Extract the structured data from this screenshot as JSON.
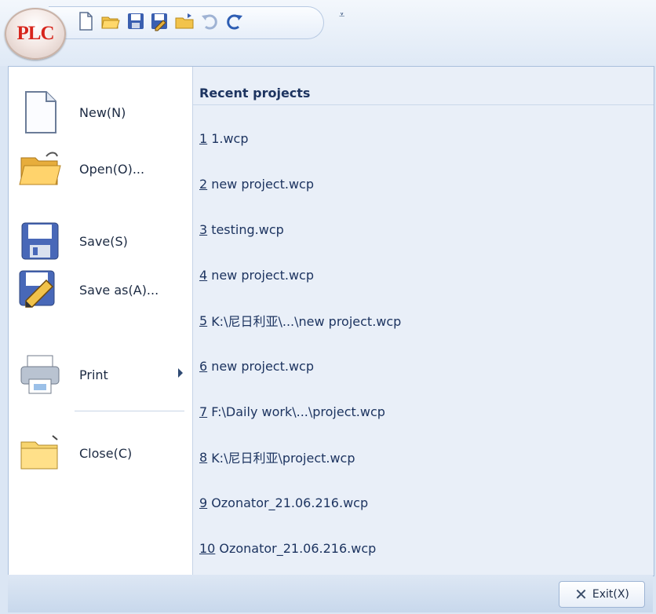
{
  "quick_access": {
    "logo_text": "PLC",
    "buttons": [
      {
        "name": "new-icon"
      },
      {
        "name": "open-icon"
      },
      {
        "name": "save-icon"
      },
      {
        "name": "save-as-icon"
      },
      {
        "name": "open-folder-icon"
      },
      {
        "name": "undo-icon"
      },
      {
        "name": "redo-icon"
      }
    ],
    "customize_glyph": "⩡"
  },
  "menu": {
    "commands": [
      {
        "label": "New(N)",
        "icon": "new-document-icon"
      },
      {
        "label": "Open(O)...",
        "icon": "open-folder-icon"
      },
      {
        "label": "Save(S)",
        "icon": "floppy-disk-icon"
      },
      {
        "label": "Save as(A)...",
        "icon": "save-as-icon"
      },
      {
        "label": "Print",
        "icon": "printer-icon",
        "submenu": true
      },
      {
        "label": "Close(C)",
        "icon": "close-folder-icon"
      }
    ],
    "recent": {
      "title": "Recent projects",
      "items": [
        {
          "num": "1",
          "name": "1.wcp"
        },
        {
          "num": "2",
          "name": "new project.wcp"
        },
        {
          "num": "3",
          "name": "testing.wcp"
        },
        {
          "num": "4",
          "name": "new project.wcp"
        },
        {
          "num": "5",
          "name": "K:\\尼日利亚\\...\\new project.wcp"
        },
        {
          "num": "6",
          "name": "new project.wcp"
        },
        {
          "num": "7",
          "name": "F:\\Daily work\\...\\project.wcp"
        },
        {
          "num": "8",
          "name": "K:\\尼日利亚\\project.wcp"
        },
        {
          "num": "9",
          "name": "Ozonator_21.06.216.wcp"
        },
        {
          "num": "10",
          "name": "Ozonator_21.06.216.wcp"
        }
      ]
    }
  },
  "footer": {
    "exit_label": "Exit(X)",
    "exit_icon": "close-x-icon"
  }
}
